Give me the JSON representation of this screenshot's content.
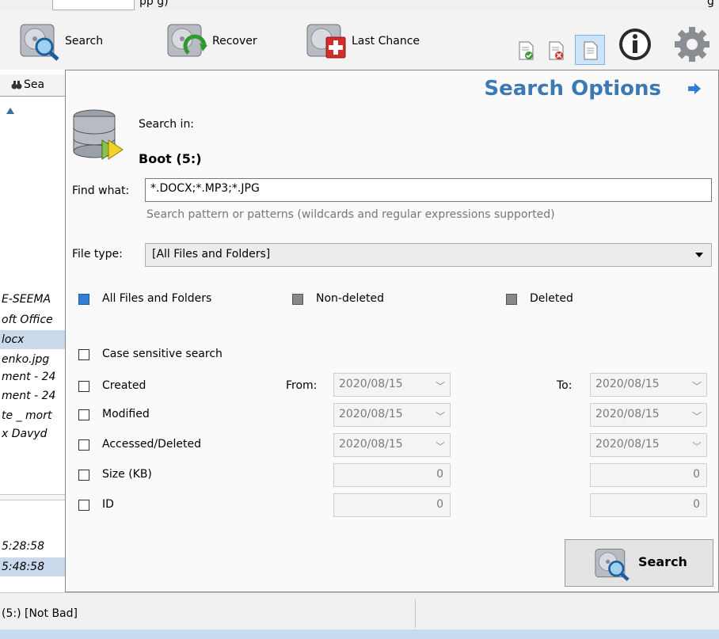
{
  "top_strip": {
    "text": "pp              g)",
    "right": "g"
  },
  "toolbar": {
    "search": "Search",
    "recover": "Recover",
    "last_chance": "Last Chance"
  },
  "left_pane": {
    "tab_label": "Sea",
    "rows": [
      {
        "text": "E-SEEMA",
        "selected": false
      },
      {
        "text": "oft Office",
        "selected": false
      },
      {
        "text": "locx",
        "selected": true
      },
      {
        "text": "enko.jpg",
        "selected": false
      },
      {
        "text": "ment - 24",
        "selected": false
      },
      {
        "text": "ment - 24",
        "selected": false
      },
      {
        "text": "te _ mort",
        "selected": false
      },
      {
        "text": "x Davyd",
        "selected": false
      }
    ],
    "times": [
      {
        "text": "5:28:58",
        "selected": false
      },
      {
        "text": "5:48:58",
        "selected": true
      }
    ]
  },
  "status": {
    "text": "(5:) [Not Bad]"
  },
  "panel": {
    "title": "Search Options",
    "search_in_label": "Search in:",
    "drive": "Boot (5:)",
    "find_label": "Find what:",
    "find_value": "*.DOCX;*.MP3;*.JPG",
    "find_hint": "Search pattern or patterns (wildcards and regular expressions supported)",
    "filetype_label": "File type:",
    "filetype_value": "[All Files and Folders]",
    "radio_all": "All Files and Folders",
    "radio_nondeleted": "Non-deleted",
    "radio_deleted": "Deleted",
    "case_sensitive": "Case sensitive search",
    "created": "Created",
    "modified": "Modified",
    "accessed": "Accessed/Deleted",
    "size": "Size (KB)",
    "id": "ID",
    "from_label": "From:",
    "to_label": "To:",
    "date_value": "2020/08/15",
    "num_value": "0",
    "search_button": "Search"
  },
  "colors": {
    "title": "#3c78b4",
    "selection": "#cad9ec",
    "radio_on": "#2f7ed8"
  }
}
